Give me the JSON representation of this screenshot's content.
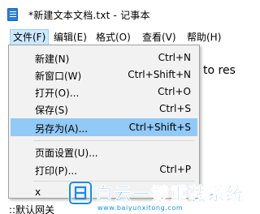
{
  "window": {
    "title": "*新建文本文档.txt - 记事本",
    "app_icon": "notepad-icon"
  },
  "menubar": {
    "items": [
      {
        "label": "文件(F)",
        "active": true
      },
      {
        "label": "编辑(E)",
        "active": false
      },
      {
        "label": "格式(O)",
        "active": false
      },
      {
        "label": "查看(V)",
        "active": false
      },
      {
        "label": "帮助(H)",
        "active": false
      }
    ]
  },
  "editor": {
    "visible_text_right": "to res",
    "visible_text_bottom": "::默认网关"
  },
  "file_menu": {
    "items": [
      {
        "label": "新建(N)",
        "shortcut": "Ctrl+N",
        "highlighted": false
      },
      {
        "label": "新窗口(W)",
        "shortcut": "Ctrl+Shift+N",
        "highlighted": false
      },
      {
        "label": "打开(O)...",
        "shortcut": "Ctrl+O",
        "highlighted": false
      },
      {
        "label": "保存(S)",
        "shortcut": "Ctrl+S",
        "highlighted": false
      },
      {
        "label": "另存为(A)...",
        "shortcut": "Ctrl+Shift+S",
        "highlighted": true
      },
      {
        "label": "页面设置(U)...",
        "shortcut": "",
        "highlighted": false
      },
      {
        "label": "打印(P)...",
        "shortcut": "Ctrl+P",
        "highlighted": false
      },
      {
        "label": "x",
        "shortcut": "",
        "highlighted": false
      }
    ]
  },
  "watermark": {
    "title": "白云一键重装系统",
    "url": "www.baiyunxitong.com",
    "logo_icon": "baiyun-logo-icon"
  },
  "colors": {
    "menu_highlight": "#91c9f7",
    "menubar_active": "#cce8ff",
    "watermark": "#1a8ee1",
    "notepad_icon": "#2b7fd8"
  }
}
